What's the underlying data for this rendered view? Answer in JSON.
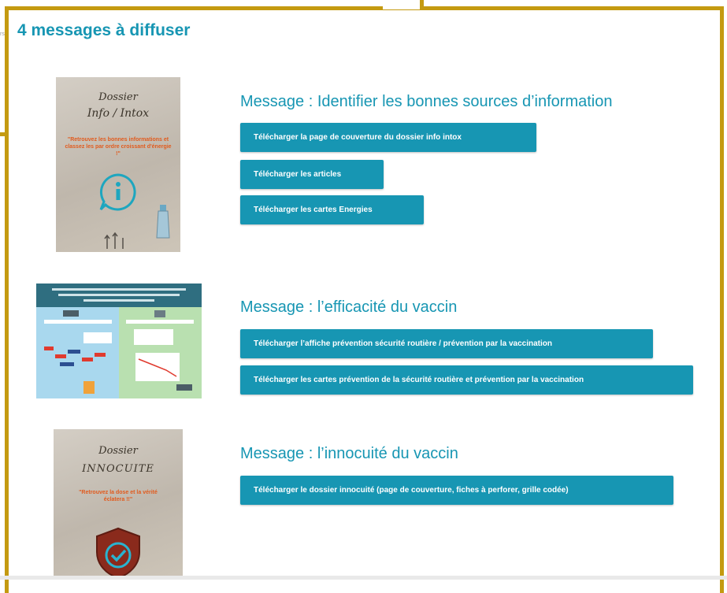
{
  "page": {
    "title": "4 messages à diffuser",
    "stray_text": "rs"
  },
  "messages": [
    {
      "title": "Message : Identifier les bonnes sources d’information",
      "thumb": {
        "line1": "Dossier",
        "line2": "Info / Intox",
        "subtitle": "\"Retrouvez les bonnes informations et classez les par ordre croissant d'énergie !\""
      },
      "buttons": [
        "Télécharger la page de couverture du dossier info intox",
        "Télécharger les articles",
        "Télécharger les cartes Energies"
      ]
    },
    {
      "title": "Message :  l’efficacité du vaccin",
      "buttons": [
        "Télécharger l’affiche prévention sécurité routière / prévention par la vaccination",
        "Télécharger les cartes prévention de la sécurité routière et prévention par la vaccination"
      ]
    },
    {
      "title": "Message :  l’innocuité du vaccin",
      "thumb": {
        "line1": "Dossier",
        "line2": "INNOCUITE",
        "subtitle": "\"Retrouvez la dose et la vérité éclatera !!\""
      },
      "buttons": [
        "Télécharger le dossier innocuité (page de couverture, fiches à perforer, grille codée)"
      ]
    }
  ],
  "colors": {
    "accent": "#1796b3",
    "frame": "#c49a11",
    "thumb_red": "#e15b1e"
  }
}
